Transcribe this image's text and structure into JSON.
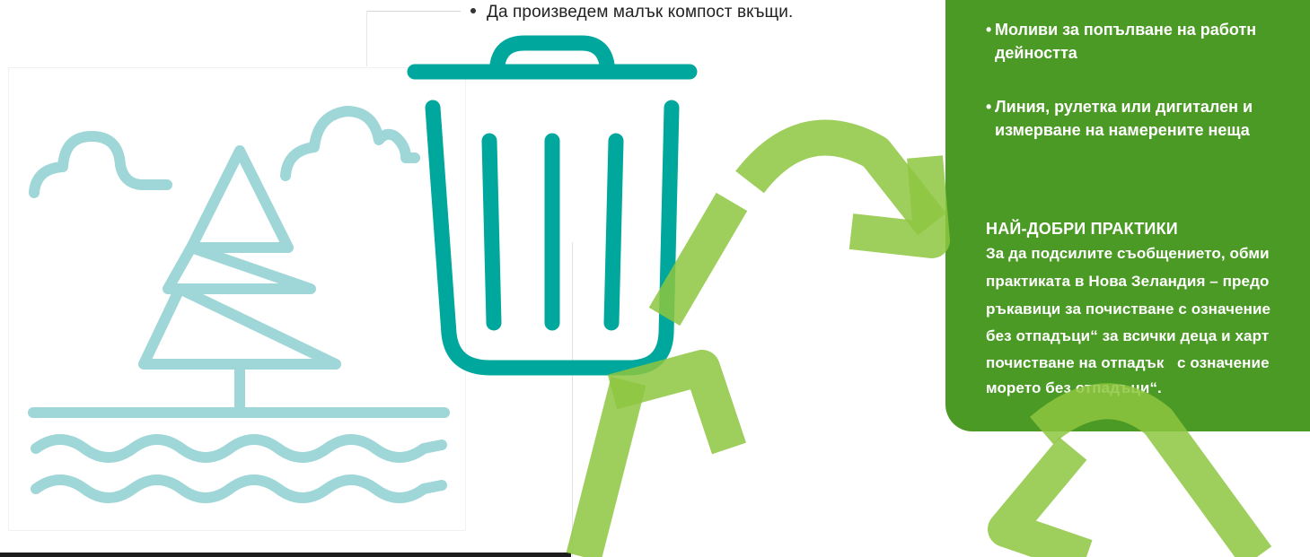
{
  "compost_bullet": "Да произведем малък компост вкъщи.",
  "materials_list": [
    {
      "lines": [
        "Моливи за попълване на работн",
        "дейността"
      ]
    },
    {
      "lines": [
        "Линия, рулетка или дигитален и",
        "измерване на намерените неща"
      ]
    }
  ],
  "best_practices": {
    "heading": "НАЙ-ДОБРИ ПРАКТИКИ",
    "lines": [
      "За да подсилите съобщението, обми",
      "практиката в Нова Зеландия – предо",
      "ръкавици за почистване с означение",
      "без отпадъци“ за всички деца и харт",
      "почистване на отпадък   с означение",
      "морето без отпадъци“."
    ]
  },
  "colors": {
    "panel_green": "#4c9a26",
    "recycle_green": "#8dc63f",
    "bin_teal": "#00a79d",
    "nature_teal": "#9fd6d8"
  },
  "icons": [
    "trash-bin-icon",
    "recycle-icon",
    "tree-icon",
    "cloud-icon",
    "waves-icon"
  ]
}
